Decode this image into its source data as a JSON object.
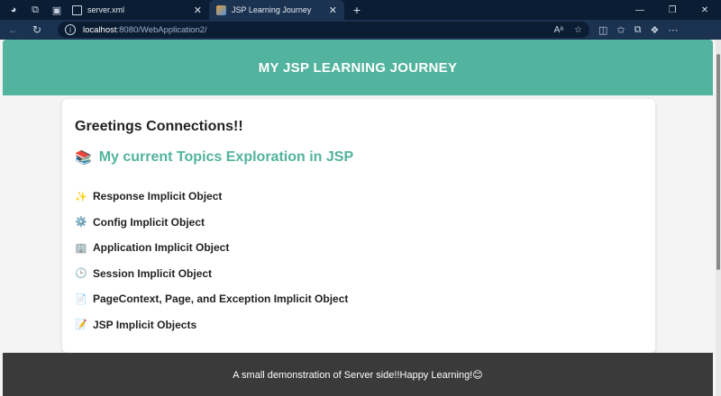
{
  "browser": {
    "tabs": [
      {
        "title": "server.xml",
        "active": false
      },
      {
        "title": "JSP Learning Journey",
        "active": true
      }
    ],
    "address": {
      "host": "localhost",
      "path": ":8080/WebApplication2/"
    }
  },
  "page": {
    "header_title": "MY JSP LEARNING JOURNEY",
    "greeting": "Greetings Connections!!",
    "topics_heading": "My current Topics Exploration in JSP",
    "topics_icon": "📚",
    "items": [
      {
        "icon": "✨",
        "label": "Response Implicit Object"
      },
      {
        "icon": "⚙️",
        "label": "Config Implicit Object"
      },
      {
        "icon": "🏢",
        "label": "Application Implicit Object"
      },
      {
        "icon": "🕒",
        "label": "Session Implicit Object"
      },
      {
        "icon": "📄",
        "label": "PageContext, Page, and Exception Implicit Object"
      },
      {
        "icon": "📝",
        "label": "JSP Implicit Objects"
      }
    ],
    "footer_text": "A small demonstration of Server side!!Happy Learning!😊"
  },
  "colors": {
    "accent": "#52b39e",
    "footer": "#3a3a3a",
    "chrome": "#0b1d33"
  }
}
